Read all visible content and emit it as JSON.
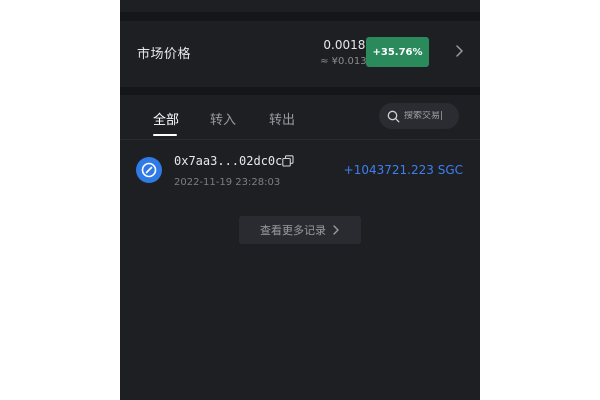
{
  "market": {
    "label": "市场价格",
    "price": "0.00187",
    "price_cny": "≈ ¥0.0131",
    "change": "+35.76%",
    "change_color": "#2a8a5c"
  },
  "tabs": [
    {
      "label": "全部",
      "active": true
    },
    {
      "label": "转入",
      "active": false
    },
    {
      "label": "转出",
      "active": false
    }
  ],
  "search": {
    "placeholder": "搜索交易|"
  },
  "transactions": [
    {
      "address": "0x7aa3...02dc0c",
      "timestamp": "2022-11-19 23:28:03",
      "amount": "+1043721.223 SGC",
      "amount_color": "#3d7ff0",
      "avatar_color": "#2f7ae5"
    }
  ],
  "more_button": {
    "label": "查看更多记录"
  },
  "icons": {
    "chevron": "chevron-right-icon",
    "search": "search-icon",
    "copy": "copy-icon",
    "avatar": "token-avatar-icon"
  }
}
